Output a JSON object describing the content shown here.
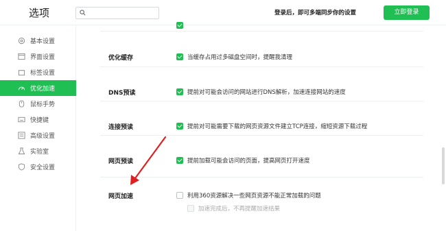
{
  "header": {
    "title": "选项",
    "search_placeholder": "",
    "login_tip": "登录后，即可多端同步你的设置",
    "login_button": "立即登录"
  },
  "sidebar": {
    "items": [
      {
        "label": "基本设置",
        "icon": "gear-icon",
        "active": false
      },
      {
        "label": "界面设置",
        "icon": "window-icon",
        "active": false
      },
      {
        "label": "标签设置",
        "icon": "tab-icon",
        "active": false
      },
      {
        "label": "优化加速",
        "icon": "speed-icon",
        "active": true
      },
      {
        "label": "鼠标手势",
        "icon": "mouse-icon",
        "active": false
      },
      {
        "label": "快捷键",
        "icon": "keyboard-icon",
        "active": false
      },
      {
        "label": "高级设置",
        "icon": "advanced-icon",
        "active": false
      },
      {
        "label": "实验室",
        "icon": "lab-icon",
        "active": false
      },
      {
        "label": "安全设置",
        "icon": "shield-icon",
        "active": false
      }
    ]
  },
  "sections": [
    {
      "label": "优化缓存",
      "options": [
        {
          "text": "当缓存占用过多磁盘空间时，提醒我清理",
          "checked": true
        }
      ]
    },
    {
      "label": "DNS预读",
      "options": [
        {
          "text": "提前对可能会访问的网站进行DNS解析，加速连接网站的速度",
          "checked": true
        }
      ]
    },
    {
      "label": "连接预读",
      "options": [
        {
          "text": "提前对可能需要下载的网页资源文件建立TCP连接，缩短资源下载过程",
          "checked": true
        }
      ]
    },
    {
      "label": "网页预读",
      "options": [
        {
          "text": "提前加载可能会访问的页面，提高网页打开速度",
          "checked": true
        }
      ]
    },
    {
      "label": "网页加速",
      "options": [
        {
          "text": "利用360资源解决一些网页资源不能正常加载的问题",
          "checked": false
        },
        {
          "text": "加速完成后，不再提醒加速结果",
          "checked": false,
          "disabled": true
        }
      ]
    }
  ],
  "colors": {
    "accent": "#1fbf53",
    "arrow": "#e02020"
  }
}
